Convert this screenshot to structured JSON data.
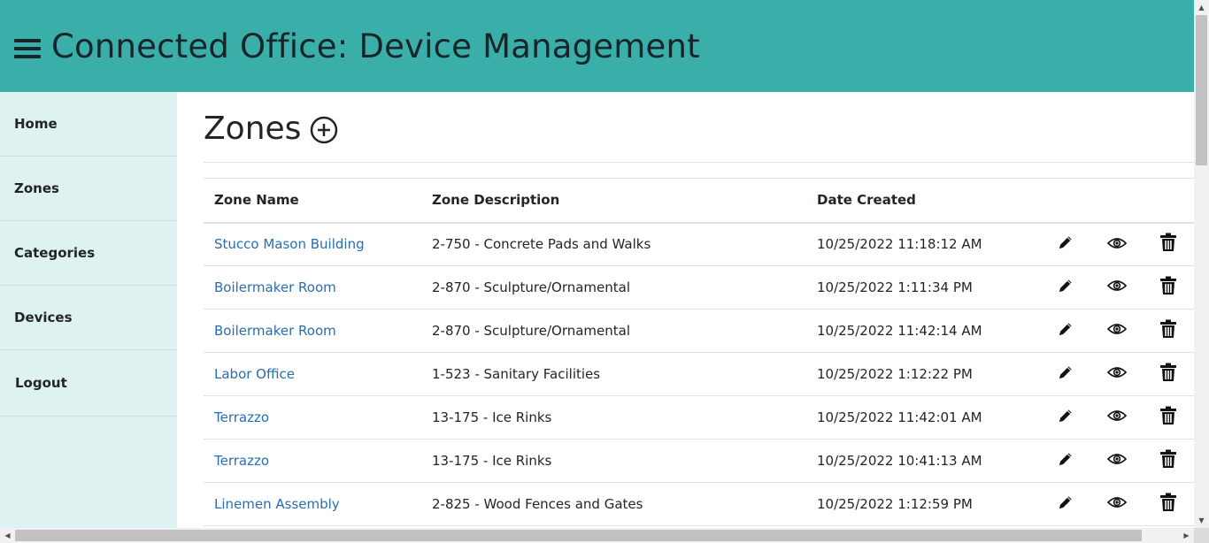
{
  "header": {
    "title": "Connected Office: Device Management"
  },
  "sidebar": {
    "items": [
      {
        "label": "Home"
      },
      {
        "label": "Zones"
      },
      {
        "label": "Categories"
      },
      {
        "label": "Devices"
      },
      {
        "label": "Logout"
      }
    ]
  },
  "page": {
    "title": "Zones"
  },
  "table": {
    "headers": [
      "Zone Name",
      "Zone Description",
      "Date Created"
    ],
    "rows": [
      {
        "name": "Stucco Mason Building",
        "description": "2-750 - Concrete Pads and Walks",
        "created": "10/25/2022 11:18:12 AM"
      },
      {
        "name": "Boilermaker Room",
        "description": "2-870 - Sculpture/Ornamental",
        "created": "10/25/2022 1:11:34 PM"
      },
      {
        "name": "Boilermaker Room",
        "description": "2-870 - Sculpture/Ornamental",
        "created": "10/25/2022 11:42:14 AM"
      },
      {
        "name": "Labor Office",
        "description": "1-523 - Sanitary Facilities",
        "created": "10/25/2022 1:12:22 PM"
      },
      {
        "name": "Terrazzo",
        "description": "13-175 - Ice Rinks",
        "created": "10/25/2022 11:42:01 AM"
      },
      {
        "name": "Terrazzo",
        "description": "13-175 - Ice Rinks",
        "created": "10/25/2022 10:41:13 AM"
      },
      {
        "name": "Linemen Assembly",
        "description": "2-825 - Wood Fences and Gates",
        "created": "10/25/2022 1:12:59 PM"
      }
    ]
  },
  "icons": {
    "menu": "hamburger-menu-icon",
    "add": "plus-circle-icon",
    "edit": "pencil-icon",
    "view": "eye-icon",
    "delete": "trash-icon"
  },
  "colors": {
    "header_bg": "#3aafa9",
    "header_text": "#17252a",
    "sidebar_bg": "#def2f1",
    "link": "#2a6db0"
  }
}
